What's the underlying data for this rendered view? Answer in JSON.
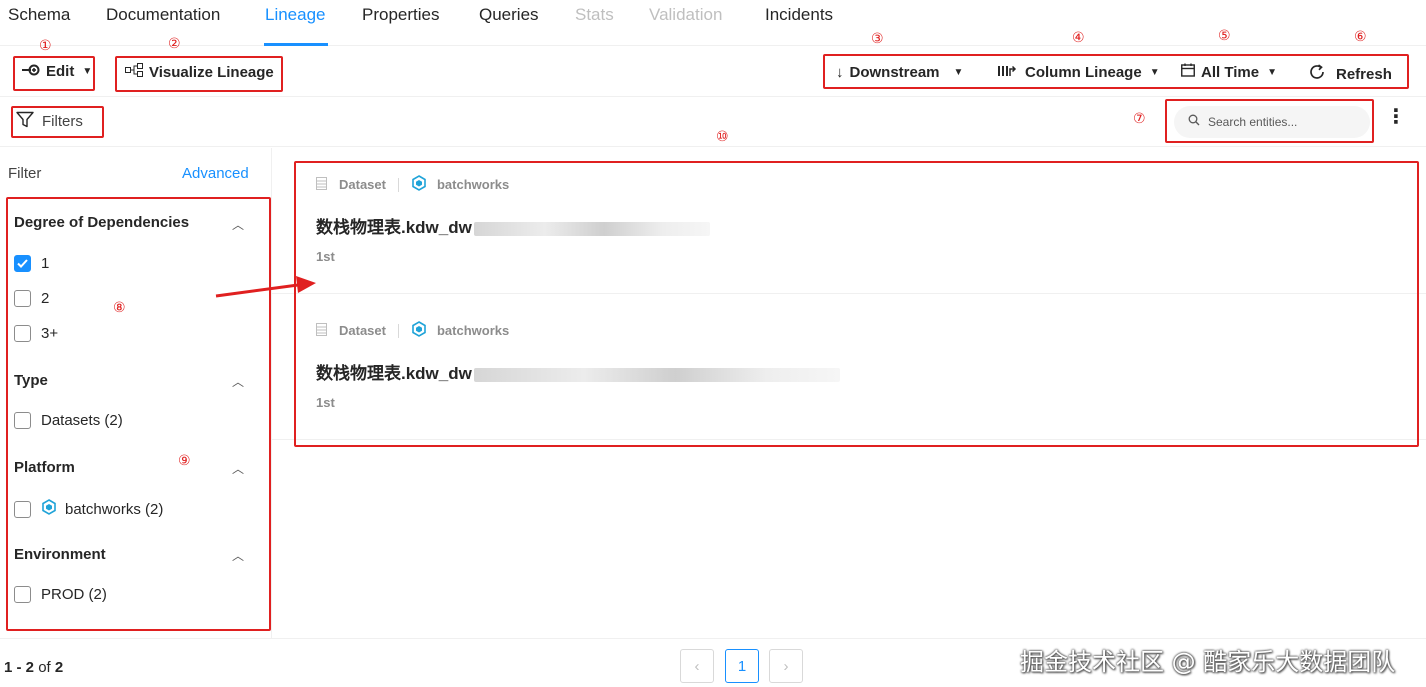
{
  "tabs": [
    {
      "label": "Schema",
      "state": "normal"
    },
    {
      "label": "Documentation",
      "state": "normal"
    },
    {
      "label": "Lineage",
      "state": "active"
    },
    {
      "label": "Properties",
      "state": "normal"
    },
    {
      "label": "Queries",
      "state": "normal"
    },
    {
      "label": "Stats",
      "state": "disabled"
    },
    {
      "label": "Validation",
      "state": "disabled"
    },
    {
      "label": "Incidents",
      "state": "normal"
    }
  ],
  "toolbar": {
    "edit_label": "Edit",
    "visualize_label": "Visualize Lineage",
    "downstream_label": "Downstream",
    "column_lineage_label": "Column Lineage",
    "time_label": "All Time",
    "refresh_label": "Refresh"
  },
  "filter_row": {
    "filters_label": "Filters",
    "search_placeholder": "Search entities..."
  },
  "annotations": [
    "①",
    "②",
    "③",
    "④",
    "⑤",
    "⑥",
    "⑦",
    "⑧",
    "⑨",
    "⑩"
  ],
  "sidebar": {
    "title": "Filter",
    "advanced_label": "Advanced",
    "sections": [
      {
        "title": "Degree of Dependencies",
        "options": [
          {
            "label": "1",
            "checked": true
          },
          {
            "label": "2",
            "checked": false
          },
          {
            "label": "3+",
            "checked": false
          }
        ]
      },
      {
        "title": "Type",
        "options": [
          {
            "label": "Datasets (2)",
            "checked": false
          }
        ]
      },
      {
        "title": "Platform",
        "options": [
          {
            "label": "batchworks (2)",
            "checked": false,
            "icon": "hexagon-icon"
          }
        ]
      },
      {
        "title": "Environment",
        "options": [
          {
            "label": "PROD (2)",
            "checked": false
          }
        ]
      }
    ]
  },
  "results": [
    {
      "type": "Dataset",
      "platform": "batchworks",
      "name": "数栈物理表.kdw_dw",
      "degree": "1st"
    },
    {
      "type": "Dataset",
      "platform": "batchworks",
      "name": "数栈物理表.kdw_dw",
      "degree": "1st"
    }
  ],
  "pagination": {
    "range": "1 - 2",
    "of_label": "of",
    "total": "2",
    "current_page": "1"
  },
  "watermark": "掘金技术社区 @ 酷家乐大数据团队",
  "colors": {
    "accent": "#1890ff",
    "annotation": "#e02020"
  }
}
